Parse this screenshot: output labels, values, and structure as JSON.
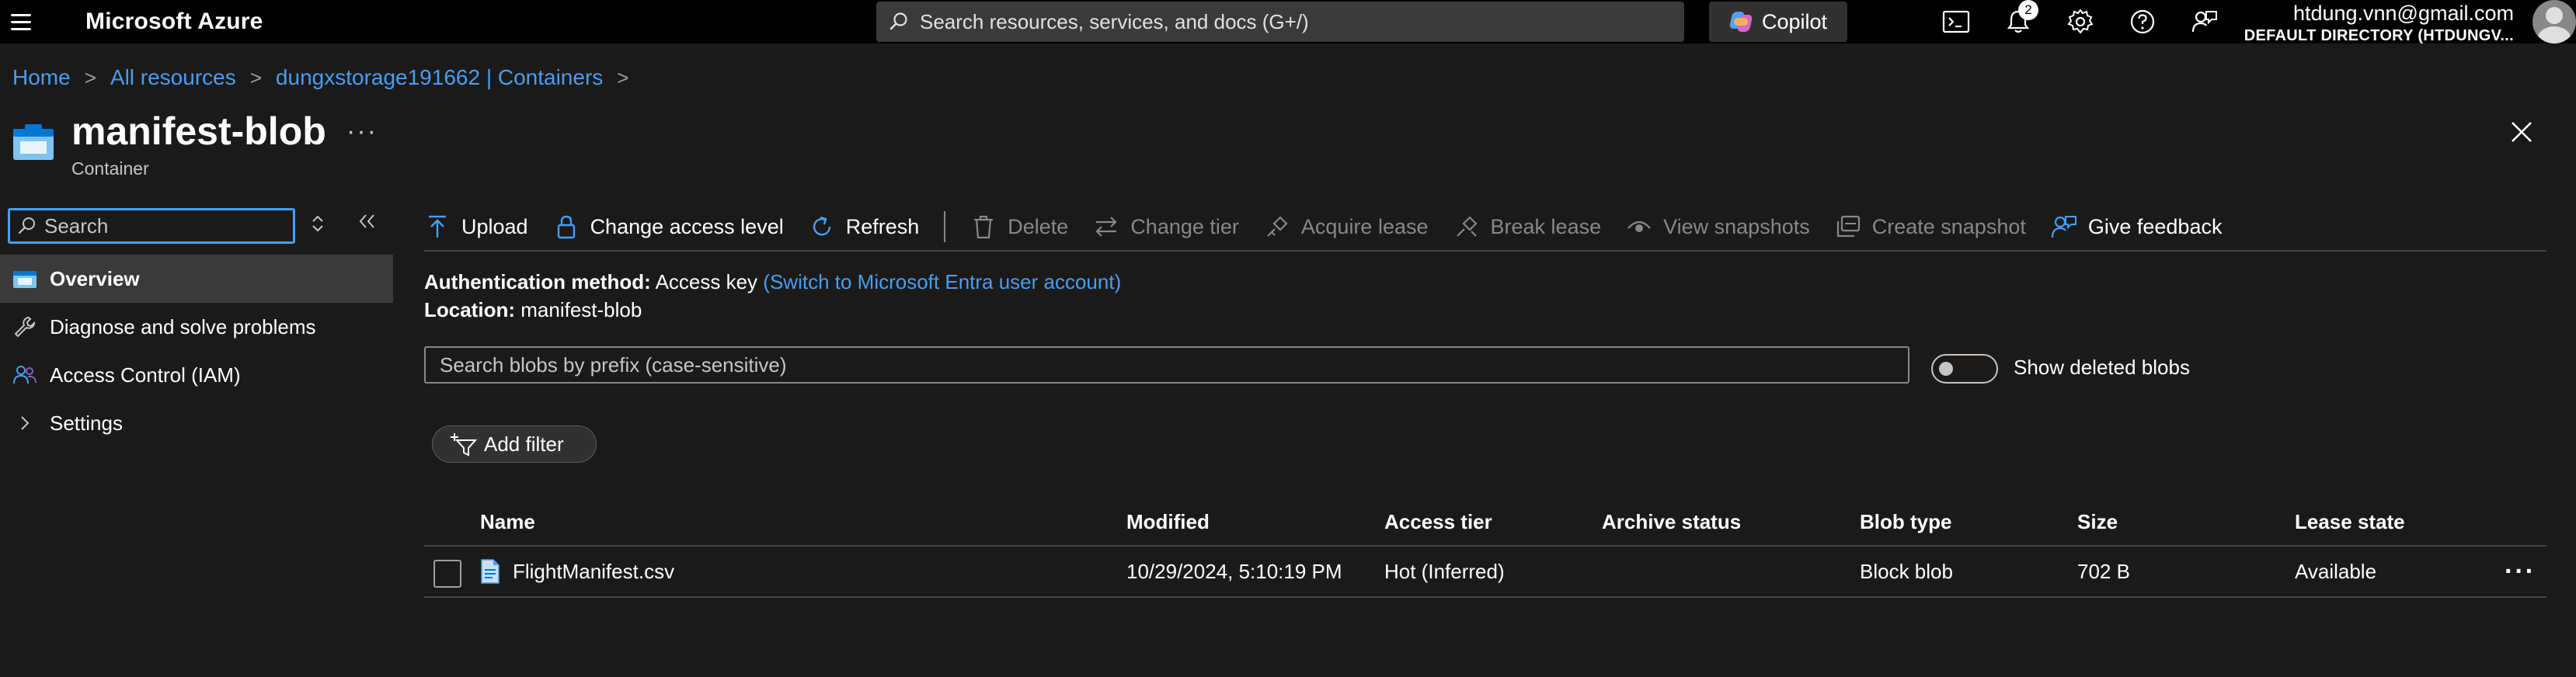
{
  "topbar": {
    "brand": "Microsoft Azure",
    "search_placeholder": "Search resources, services, and docs (G+/)",
    "copilot_label": "Copilot",
    "notification_count": "2",
    "account_email": "htdung.vnn@gmail.com",
    "account_directory": "DEFAULT DIRECTORY (HTDUNGV..."
  },
  "breadcrumb": {
    "items": [
      "Home",
      "All resources",
      "dungxstorage191662 | Containers"
    ],
    "separator": ">"
  },
  "resource": {
    "title": "manifest-blob",
    "subtitle": "Container",
    "more": "···"
  },
  "nav": {
    "search_placeholder": "Search",
    "items": [
      {
        "label": "Overview",
        "icon": "container-icon"
      },
      {
        "label": "Diagnose and solve problems",
        "icon": "wrench-icon"
      },
      {
        "label": "Access Control (IAM)",
        "icon": "people-icon"
      },
      {
        "label": "Settings",
        "icon": "chevron-right-icon"
      }
    ]
  },
  "toolbar": {
    "upload": "Upload",
    "change_access_level": "Change access level",
    "refresh": "Refresh",
    "delete": "Delete",
    "change_tier": "Change tier",
    "acquire_lease": "Acquire lease",
    "break_lease": "Break lease",
    "view_snapshots": "View snapshots",
    "create_snapshot": "Create snapshot",
    "give_feedback": "Give feedback"
  },
  "info": {
    "auth_label": "Authentication method:",
    "auth_value": "Access key",
    "auth_link": "(Switch to Microsoft Entra user account)",
    "location_label": "Location:",
    "location_value": "manifest-blob"
  },
  "blob_search": {
    "placeholder": "Search blobs by prefix (case-sensitive)",
    "show_deleted_label": "Show deleted blobs"
  },
  "add_filter_label": "Add filter",
  "table": {
    "columns": [
      "Name",
      "Modified",
      "Access tier",
      "Archive status",
      "Blob type",
      "Size",
      "Lease state"
    ],
    "rows": [
      {
        "name": "FlightManifest.csv",
        "modified": "10/29/2024, 5:10:19 PM",
        "access_tier": "Hot (Inferred)",
        "archive_status": "",
        "blob_type": "Block blob",
        "size": "702 B",
        "lease_state": "Available",
        "more": "···"
      }
    ]
  },
  "colors": {
    "accent": "#479ef5",
    "background": "#1b1a19",
    "topbar": "#000000"
  }
}
